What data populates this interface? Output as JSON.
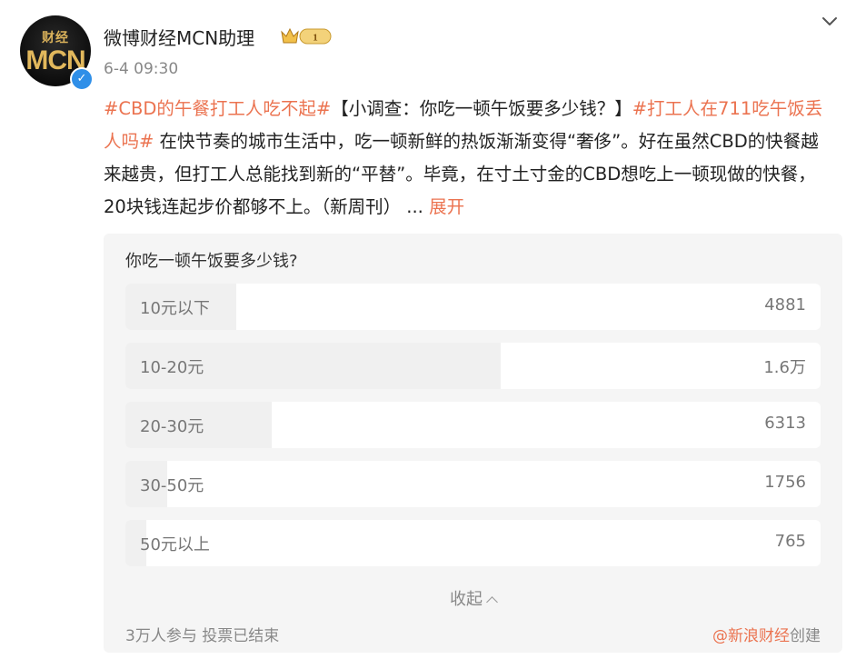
{
  "author": {
    "avatar_text_top": "财经",
    "avatar_text_main": "MCN",
    "name": "微博财经MCN助理",
    "level": "1",
    "time": "6-4 09:30"
  },
  "post": {
    "hashtag1": "#CBD的午餐打工人吃不起#",
    "text1": "【小调查：你吃一顿午饭要多少钱？】",
    "hashtag2": "#打工人在711吃午饭丢人吗#",
    "text2": " 在快节奏的城市生活中，吃一顿新鲜的热饭渐渐变得“奢侈”。好在虽然CBD的快餐越来越贵，但打工人总能找到新的“平替”。毕竟，在寸土寸金的CBD想吃上一顿现做的快餐，20块钱连起步价都够不上。（新周刊）",
    "ellipsis": " ... ",
    "expand_label": "展开"
  },
  "poll": {
    "question": "你吃一顿午饭要多少钱?",
    "options": [
      {
        "label": "10元以下",
        "count": "4881",
        "percent": 16
      },
      {
        "label": "10-20元",
        "count": "1.6万",
        "percent": 54
      },
      {
        "label": "20-30元",
        "count": "6313",
        "percent": 21
      },
      {
        "label": "30-50元",
        "count": "1756",
        "percent": 6
      },
      {
        "label": "50元以上",
        "count": "765",
        "percent": 3
      }
    ],
    "collapse_label": "收起",
    "participants": "3万人参与 投票已结束",
    "creator_handle": "@新浪财经",
    "creator_suffix": "创建"
  },
  "colors": {
    "accent": "#eb7350",
    "verified": "#2f8fe8",
    "poll_bg": "#f5f5f5",
    "bar_fill": "#f0f0f0"
  }
}
